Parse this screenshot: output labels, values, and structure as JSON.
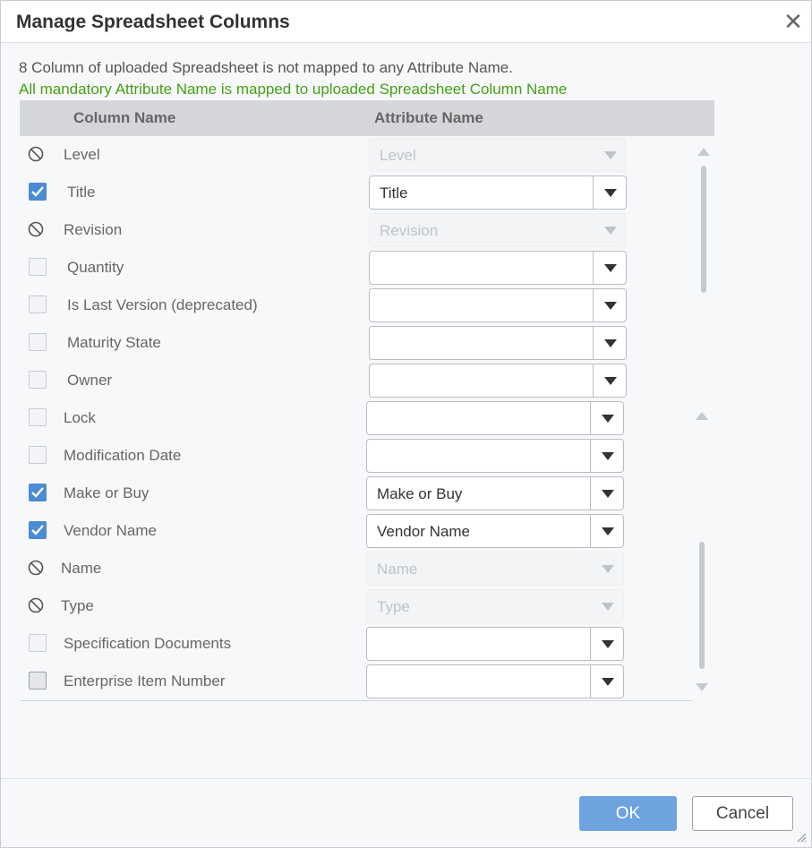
{
  "dialog": {
    "title": "Manage Spreadsheet Columns",
    "close_glyph": "✕",
    "message_warning": "8 Column of uploaded Spreadsheet is not mapped to any Attribute Name.",
    "message_success": "All mandatory Attribute Name is mapped to uploaded Spreadsheet Column Name",
    "success_color": "#46a015"
  },
  "table": {
    "headers": {
      "column_name": "Column Name",
      "attribute_name": "Attribute Name"
    },
    "rows": [
      {
        "column": "Level",
        "state": "disabled",
        "attribute": "Level"
      },
      {
        "column": "Title",
        "state": "checked",
        "attribute": "Title"
      },
      {
        "column": "Revision",
        "state": "disabled",
        "attribute": "Revision"
      },
      {
        "column": "Quantity",
        "state": "unchecked",
        "attribute": ""
      },
      {
        "column": "Is Last Version (deprecated)",
        "state": "unchecked",
        "attribute": ""
      },
      {
        "column": "Maturity State",
        "state": "unchecked",
        "attribute": ""
      },
      {
        "column": "Owner",
        "state": "unchecked",
        "attribute": ""
      },
      {
        "column": "Lock",
        "state": "unchecked",
        "attribute": ""
      },
      {
        "column": "Modification Date",
        "state": "unchecked",
        "attribute": ""
      },
      {
        "column": "Make or Buy",
        "state": "checked",
        "attribute": "Make or Buy"
      },
      {
        "column": "Vendor Name",
        "state": "checked",
        "attribute": "Vendor Name"
      },
      {
        "column": "Name",
        "state": "disabled",
        "attribute": "Name"
      },
      {
        "column": "Type",
        "state": "disabled",
        "attribute": "Type"
      },
      {
        "column": "Specification Documents",
        "state": "unchecked",
        "attribute": ""
      },
      {
        "column": "Enterprise Item Number",
        "state": "unchecked",
        "attribute": ""
      }
    ]
  },
  "footer": {
    "ok_label": "OK",
    "cancel_label": "Cancel"
  },
  "colors": {
    "accent": "#4a8bd4",
    "ok_button": "#6da4e0"
  }
}
